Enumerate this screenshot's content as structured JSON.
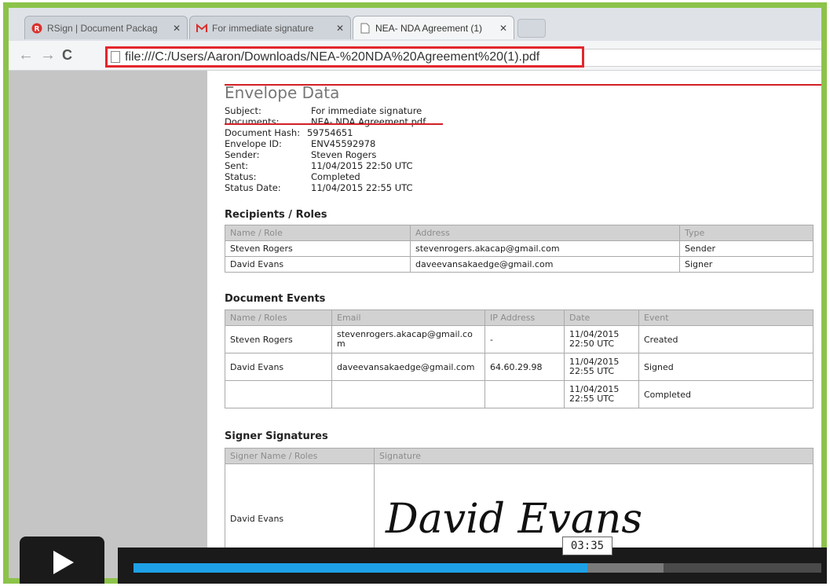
{
  "browser": {
    "tabs": [
      {
        "title": "RSign | Document Packag",
        "active": false
      },
      {
        "title": "For immediate signature",
        "active": false
      },
      {
        "title": "NEA- NDA Agreement (1)",
        "active": true
      }
    ],
    "url": "file:///C:/Users/Aaron/Downloads/NEA-%20NDA%20Agreement%20(1).pdf"
  },
  "envelope": {
    "heading": "Envelope Data",
    "fields": [
      {
        "key": "Subject:",
        "value": "For immediate signature"
      },
      {
        "key": "Documents:",
        "value": "NEA- NDA Agreement.pdf"
      },
      {
        "key": "Document Hash:",
        "value": "59754651"
      },
      {
        "key": "Envelope ID:",
        "value": "ENV45592978"
      },
      {
        "key": "Sender:",
        "value": "Steven Rogers"
      },
      {
        "key": "Sent:",
        "value": "11/04/2015 22:50 UTC"
      },
      {
        "key": "Status:",
        "value": "Completed"
      },
      {
        "key": "Status Date:",
        "value": "11/04/2015 22:55 UTC"
      }
    ]
  },
  "recipients": {
    "heading": "Recipients / Roles",
    "columns": [
      "Name / Role",
      "Address",
      "Type"
    ],
    "rows": [
      [
        "Steven Rogers",
        "stevenrogers.akacap@gmail.com",
        "Sender"
      ],
      [
        "David Evans",
        "daveevansakaedge@gmail.com",
        "Signer"
      ]
    ]
  },
  "events": {
    "heading": "Document Events",
    "columns": [
      "Name / Roles",
      "Email",
      "IP Address",
      "Date",
      "Event"
    ],
    "rows": [
      [
        "Steven Rogers",
        "stevenrogers.akacap@gmail.co m",
        "-",
        "11/04/2015 22:50 UTC",
        "Created"
      ],
      [
        "David Evans",
        "daveevansakaedge@gmail.com",
        "64.60.29.98",
        "11/04/2015 22:55 UTC",
        "Signed"
      ],
      [
        "",
        "",
        "",
        "11/04/2015 22:55 UTC",
        "Completed"
      ]
    ]
  },
  "signatures": {
    "heading": "Signer Signatures",
    "columns": [
      "Signer Name / Roles",
      "Signature"
    ],
    "rows": [
      [
        "David Evans",
        "David Evans"
      ]
    ]
  },
  "video": {
    "time": "03:35",
    "progress": 0.66,
    "buffered": 0.77
  },
  "colors": {
    "frame": "#8cc34a",
    "highlight": "#e3262d",
    "progress": "#1ea0e6"
  }
}
